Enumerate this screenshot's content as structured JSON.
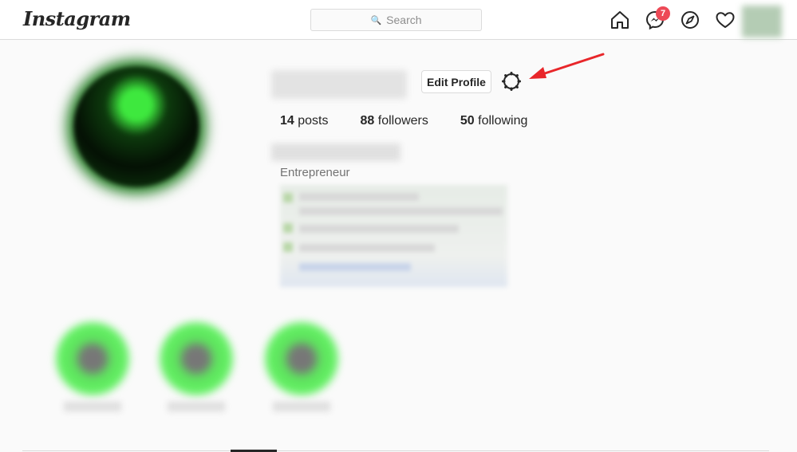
{
  "header": {
    "logo_text": "Instagram",
    "search_placeholder": "Search",
    "messenger_badge": "7",
    "icons": [
      "home-icon",
      "messenger-icon",
      "explore-icon",
      "activity-heart-icon",
      "profile-avatar"
    ]
  },
  "profile": {
    "edit_button_label": "Edit Profile",
    "settings_icon": "gear-icon",
    "stats": [
      {
        "count": "14",
        "label": "posts"
      },
      {
        "count": "88",
        "label": "followers"
      },
      {
        "count": "50",
        "label": "following"
      }
    ],
    "bio_category": "Entrepreneur"
  },
  "highlights_count": 3,
  "colors": {
    "accent_arrow": "#e8262a",
    "badge": "#ed4956",
    "border": "#dbdbdb",
    "background": "#fafafa"
  }
}
